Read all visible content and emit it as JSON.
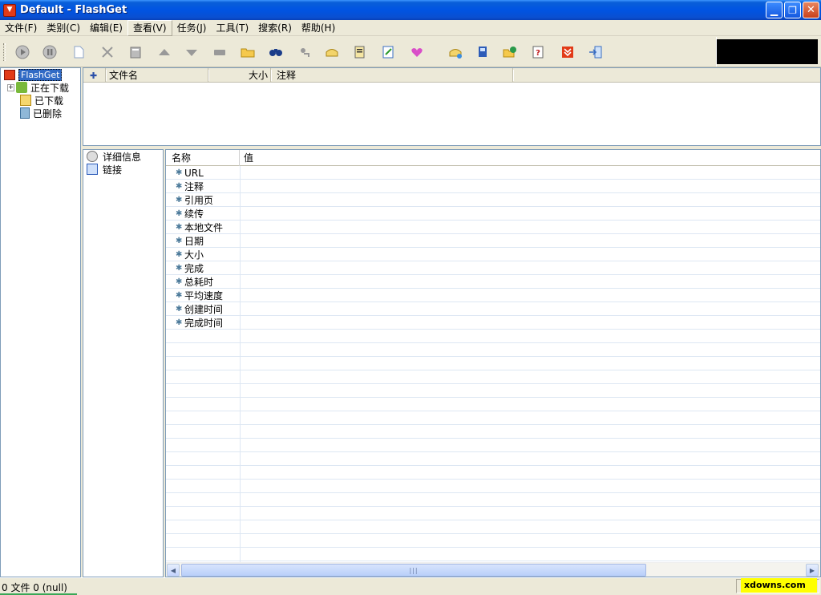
{
  "window": {
    "title": "Default - FlashGet",
    "icon": "flashget-icon"
  },
  "menubar": {
    "items": [
      "文件(F)",
      "类别(C)",
      "编辑(E)",
      "查看(V)",
      "任务(J)",
      "工具(T)",
      "搜索(R)",
      "帮助(H)"
    ],
    "active_index": 3
  },
  "toolbar": {
    "buttons": [
      "start-icon",
      "pause-icon",
      "new-icon",
      "delete-icon",
      "properties-icon",
      "move-up-icon",
      "move-down-icon",
      "schedule-icon",
      "open-folder-icon",
      "find-icon",
      "find-next-icon",
      "dial-icon",
      "batch-icon",
      "edit-icon",
      "favorite-icon",
      "hangup-icon",
      "monitor-icon",
      "web-icon",
      "help-icon",
      "flashget-logo-icon",
      "exit-icon"
    ]
  },
  "tree": {
    "root": "FlashGet",
    "children": [
      "正在下载",
      "已下载",
      "已删除"
    ]
  },
  "file_list": {
    "columns": [
      "文件名",
      "大小",
      "注释"
    ]
  },
  "info_categories": [
    "详细信息",
    "链接"
  ],
  "details": {
    "col_name": "名称",
    "col_value": "值",
    "rows": [
      "URL",
      "注释",
      "引用页",
      "续传",
      "本地文件",
      "日期",
      "大小",
      "完成",
      "总耗时",
      "平均速度",
      "创建时间",
      "完成时间"
    ]
  },
  "status": {
    "text": "0 文件 0 (null)",
    "brand": "xdowns.com"
  }
}
